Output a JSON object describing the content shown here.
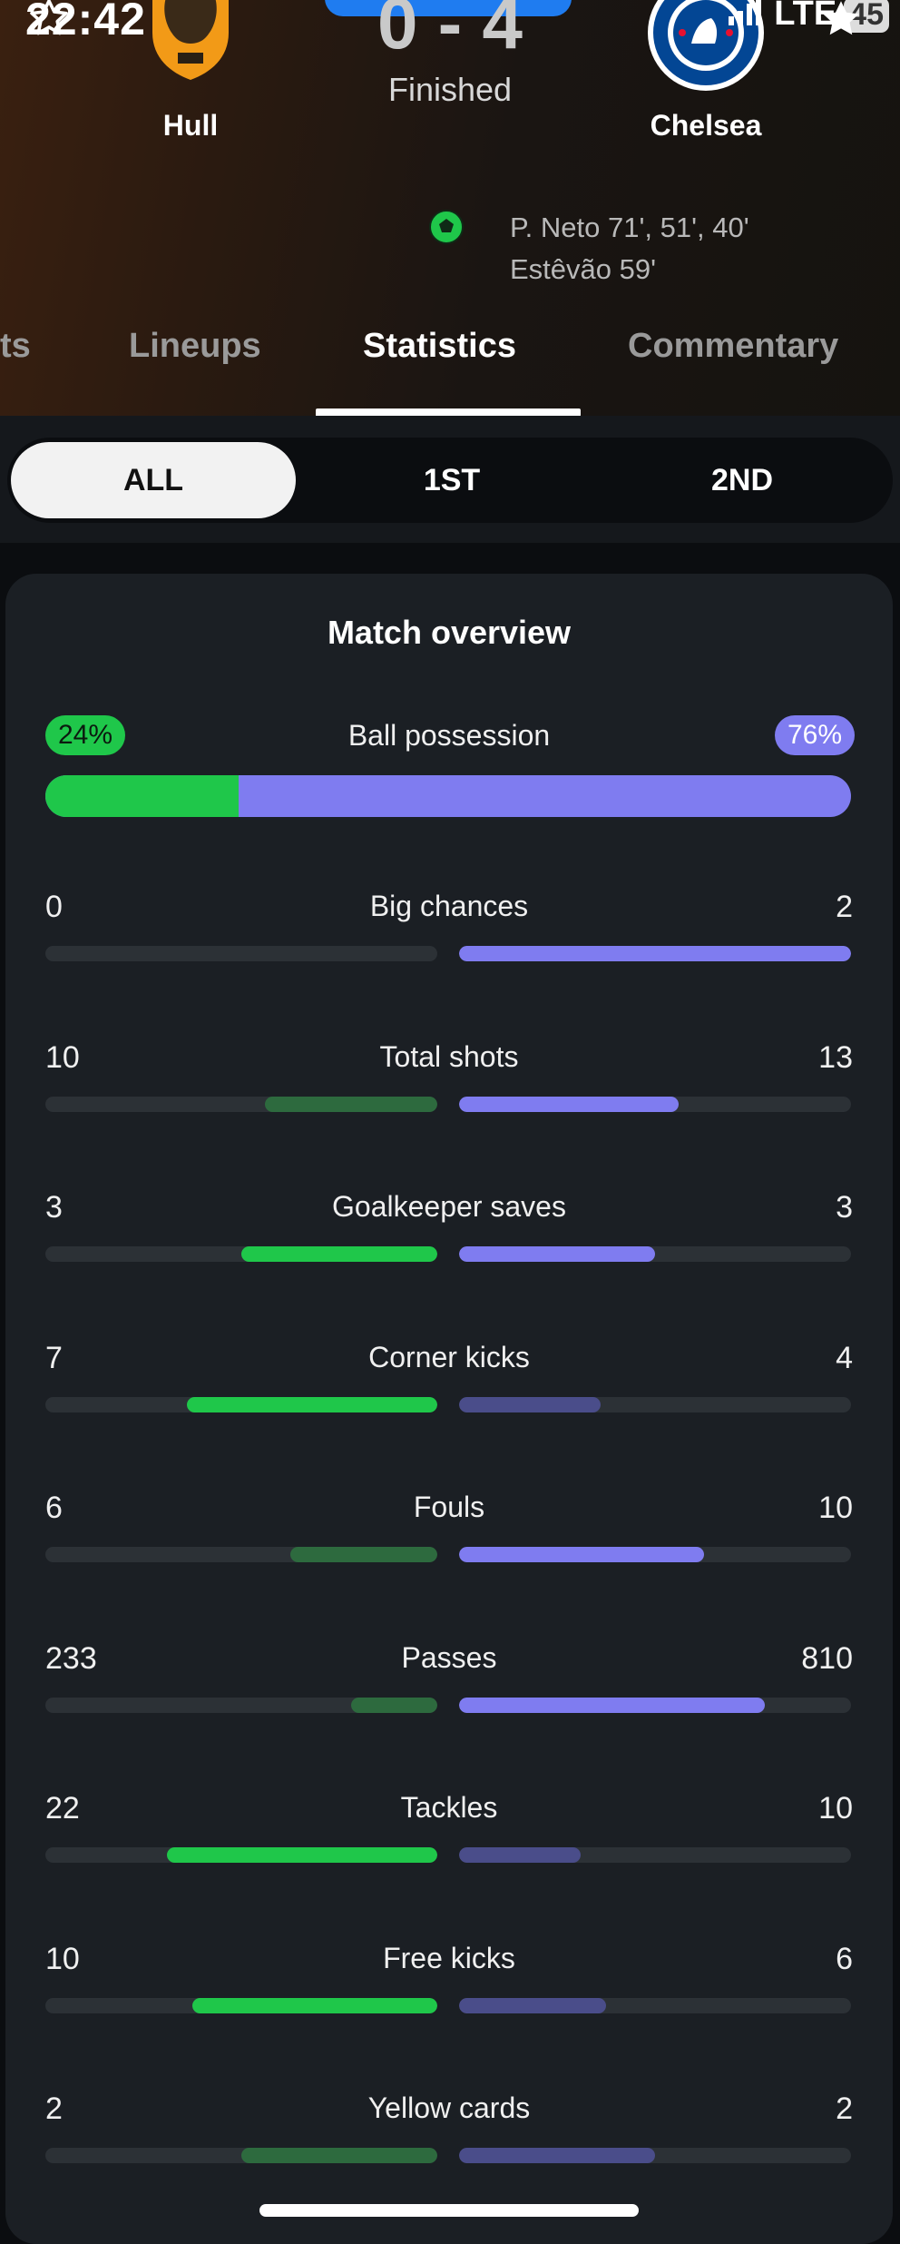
{
  "status_bar": {
    "time": "22:42",
    "network": "LTE",
    "battery": "45"
  },
  "match": {
    "home_team": "Hull",
    "away_team": "Chelsea",
    "score": "0 - 4",
    "status": "Finished",
    "scorers": [
      "P. Neto 71', 51', 40'",
      "Estêvão 59'"
    ]
  },
  "tabs": [
    {
      "label": "ts",
      "active": false
    },
    {
      "label": "Lineups",
      "active": false
    },
    {
      "label": "Statistics",
      "active": true
    },
    {
      "label": "Commentary",
      "active": false
    }
  ],
  "period_filter": {
    "options": [
      "ALL",
      "1ST",
      "2ND"
    ],
    "selected": "ALL"
  },
  "overview": {
    "title": "Match overview",
    "possession": {
      "label": "Ball possession",
      "home": "24%",
      "away": "76%",
      "home_fraction": 0.24
    },
    "stats": [
      {
        "label": "Big chances",
        "home": "0",
        "away": "2",
        "home_fill": 0.0,
        "away_fill": 1.0,
        "leader": "away"
      },
      {
        "label": "Total shots",
        "home": "10",
        "away": "13",
        "home_fill": 0.44,
        "away_fill": 0.56,
        "leader": "away"
      },
      {
        "label": "Goalkeeper saves",
        "home": "3",
        "away": "3",
        "home_fill": 0.5,
        "away_fill": 0.5,
        "leader": "both"
      },
      {
        "label": "Corner kicks",
        "home": "7",
        "away": "4",
        "home_fill": 0.64,
        "away_fill": 0.36,
        "leader": "home"
      },
      {
        "label": "Fouls",
        "home": "6",
        "away": "10",
        "home_fill": 0.375,
        "away_fill": 0.625,
        "leader": "away"
      },
      {
        "label": "Passes",
        "home": "233",
        "away": "810",
        "home_fill": 0.22,
        "away_fill": 0.78,
        "leader": "away"
      },
      {
        "label": "Tackles",
        "home": "22",
        "away": "10",
        "home_fill": 0.69,
        "away_fill": 0.31,
        "leader": "home"
      },
      {
        "label": "Free kicks",
        "home": "10",
        "away": "6",
        "home_fill": 0.625,
        "away_fill": 0.375,
        "leader": "home"
      },
      {
        "label": "Yellow cards",
        "home": "2",
        "away": "2",
        "home_fill": 0.5,
        "away_fill": 0.5,
        "leader": "none"
      }
    ]
  },
  "colors": {
    "home_accent": "#1fc74a",
    "away_accent": "#7f7cf0",
    "home_dim": "#2d6a3e",
    "away_dim": "#4a4d8a",
    "track": "#2c3136"
  },
  "icons": [
    "star-icon",
    "signal-icon",
    "battery-icon",
    "hull-crest-icon",
    "chelsea-crest-icon",
    "football-icon"
  ]
}
